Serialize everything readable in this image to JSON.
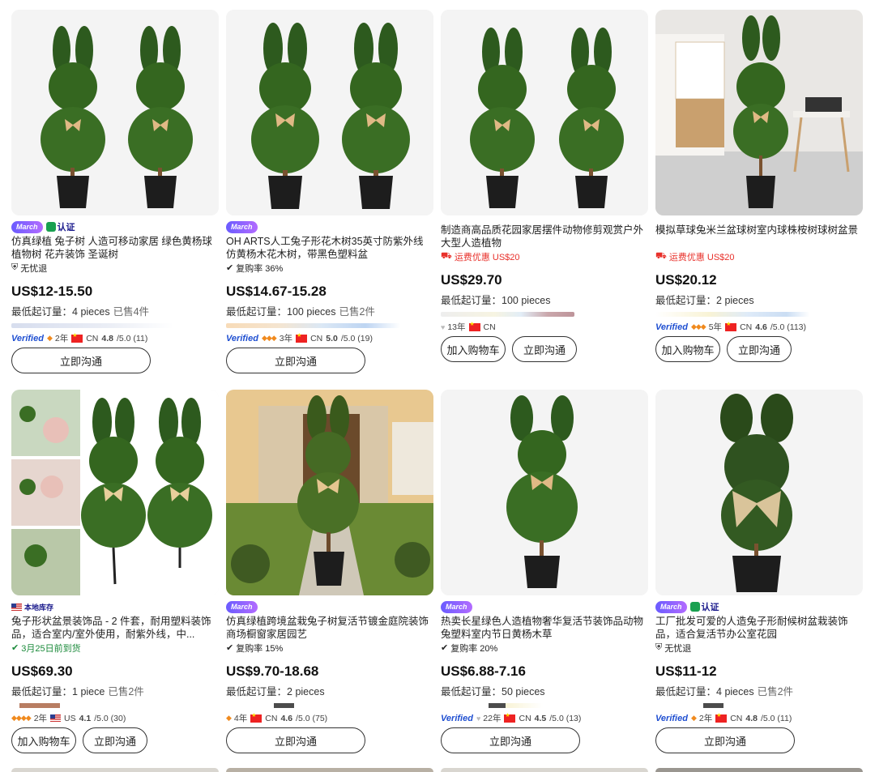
{
  "products": [
    {
      "badges": {
        "march": "March",
        "cert": "认证"
      },
      "title": "仿真绿植 兔子树 人造可移动家居 绿色黄杨球 植物树 花卉装饰 圣诞树",
      "meta": "无忧退",
      "price": "US$12-15.50",
      "moq_label": "最低起订量：",
      "moq_value": "4 pieces",
      "sold": "已售4件",
      "supplier": {
        "verified": "Verified",
        "years": "2年",
        "country": "CN",
        "rating": "4.8",
        "rating_max": "/5.0 (11)"
      },
      "buttons": [
        "立即沟通"
      ]
    },
    {
      "badges": {
        "march": "March"
      },
      "title": "OH ARTS人工兔子形花木树35英寸防紫外线仿黄杨木花木树，带黑色塑料盆",
      "meta": "复购率 36%",
      "price": "US$14.67-15.28",
      "moq_label": "最低起订量：",
      "moq_value": "100 pieces",
      "sold": "已售2件",
      "supplier": {
        "verified": "Verified",
        "years": "3年",
        "country": "CN",
        "rating": "5.0",
        "rating_max": "/5.0 (19)"
      },
      "buttons": [
        "立即沟通"
      ]
    },
    {
      "title": "制造商高品质花园家居摆件动物修剪观赏户外大型人造植物",
      "meta": "运费优惠 US$20",
      "price": "US$29.70",
      "moq_label": "最低起订量：",
      "moq_value": "100 pieces",
      "sold": "",
      "supplier": {
        "verified": "",
        "years": "13年",
        "country": "CN",
        "rating": "",
        "rating_max": ""
      },
      "buttons": [
        "加入购物车",
        "立即沟通"
      ]
    },
    {
      "title": "模拟草球兔米兰盆球树室内球株桉树球树盆景",
      "meta": "运费优惠 US$20",
      "price": "US$20.12",
      "moq_label": "最低起订量：",
      "moq_value": "2 pieces",
      "sold": "",
      "supplier": {
        "verified": "Verified",
        "years": "5年",
        "country": "CN",
        "rating": "4.6",
        "rating_max": "/5.0 (113)"
      },
      "buttons": [
        "加入购物车",
        "立即沟通"
      ]
    },
    {
      "badges": {
        "local": "本地库存"
      },
      "title": "兔子形状盆景装饰品 - 2 件套，耐用塑料装饰品，适合室内/室外使用，耐紫外线，中...",
      "meta": "3月25日前到货",
      "price": "US$69.30",
      "moq_label": "最低起订量：",
      "moq_value": "1 piece",
      "sold": "已售2件",
      "supplier": {
        "verified": "",
        "years": "2年",
        "country": "US",
        "rating": "4.1",
        "rating_max": "/5.0 (30)"
      },
      "buttons": [
        "加入购物车",
        "立即沟通"
      ]
    },
    {
      "badges": {
        "march": "March"
      },
      "title": "仿真绿植跨境盆栽兔子树复活节镀金庭院装饰商场橱窗家居园艺",
      "meta": "复购率 15%",
      "price": "US$9.70-18.68",
      "moq_label": "最低起订量：",
      "moq_value": "2 pieces",
      "sold": "",
      "supplier": {
        "verified": "",
        "years": "4年",
        "country": "CN",
        "rating": "4.6",
        "rating_max": "/5.0 (75)"
      },
      "buttons": [
        "立即沟通"
      ]
    },
    {
      "badges": {
        "march": "March"
      },
      "title": "热卖长星绿色人造植物奢华复活节装饰品动物兔塑料室内节日黄杨木草",
      "meta": "复购率 20%",
      "price": "US$6.88-7.16",
      "moq_label": "最低起订量：",
      "moq_value": "50 pieces",
      "sold": "",
      "supplier": {
        "verified": "Verified",
        "years": "22年",
        "country": "CN",
        "rating": "4.5",
        "rating_max": "/5.0 (13)"
      },
      "buttons": [
        "立即沟通"
      ]
    },
    {
      "badges": {
        "march": "March",
        "cert": "认证"
      },
      "title": "工厂批发可爱的人造兔子形耐候树盆栽装饰品，适合复活节办公室花园",
      "meta": "无忧退",
      "price": "US$11-12",
      "moq_label": "最低起订量：",
      "moq_value": "4 pieces",
      "sold": "已售2件",
      "supplier": {
        "verified": "Verified",
        "years": "2年",
        "country": "CN",
        "rating": "4.8",
        "rating_max": "/5.0 (11)"
      },
      "buttons": [
        "立即沟通"
      ]
    }
  ],
  "colors": {
    "accent_red": "#e8302a",
    "verified_blue": "#1f4fd1",
    "march_purple": "#7b5cff",
    "topiary_green": "#2f5a1f",
    "bow_tan": "#d9b27a"
  },
  "icons": [
    "shield-check-icon",
    "checkmark-icon",
    "truck-icon",
    "green-check-icon",
    "diamond-icon",
    "leaf-cert-icon"
  ]
}
